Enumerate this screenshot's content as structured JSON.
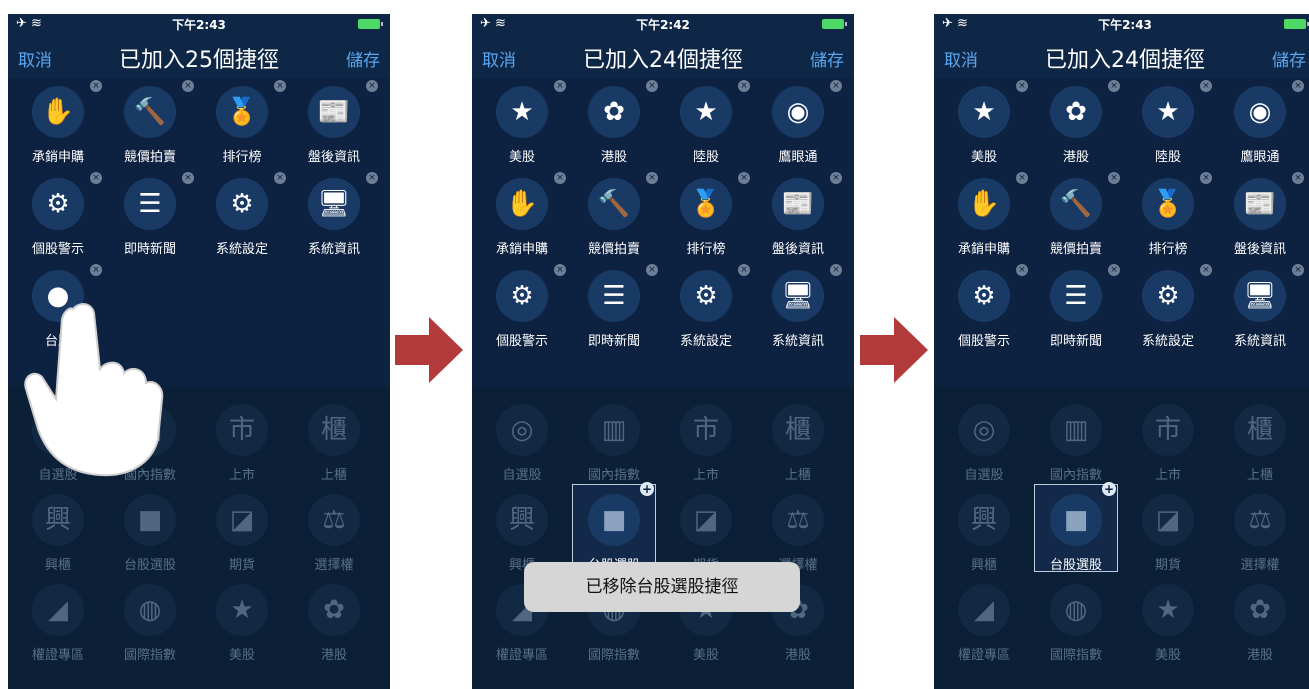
{
  "screens": [
    {
      "time": "下午2:43",
      "cancel": "取消",
      "title": "已加入25個捷徑",
      "save": "儲存",
      "added": [
        {
          "label": "承銷申購",
          "icon": "hand-icon"
        },
        {
          "label": "競價拍賣",
          "icon": "gavel-icon"
        },
        {
          "label": "排行榜",
          "icon": "medal-icon"
        },
        {
          "label": "盤後資訊",
          "icon": "document-icon"
        },
        {
          "label": "個股警示",
          "icon": "alert-gear-icon"
        },
        {
          "label": "即時新聞",
          "icon": "news-icon"
        },
        {
          "label": "系統設定",
          "icon": "gear-icon"
        },
        {
          "label": "系統資訊",
          "icon": "monitor-icon"
        },
        {
          "label": "台股",
          "icon": "taiwan-flag-icon"
        }
      ],
      "available": [
        {
          "label": "自選股"
        },
        {
          "label": "國內指數"
        },
        {
          "label": "上市"
        },
        {
          "label": "上櫃"
        },
        {
          "label": "興櫃"
        },
        {
          "label": "台股選股"
        },
        {
          "label": "期貨"
        },
        {
          "label": "選擇權"
        },
        {
          "label": "權證專區"
        },
        {
          "label": "國際指數"
        },
        {
          "label": "美股"
        },
        {
          "label": "港股"
        }
      ]
    },
    {
      "time": "下午2:42",
      "cancel": "取消",
      "title": "已加入24個捷徑",
      "save": "儲存",
      "added": [
        {
          "label": "美股",
          "icon": "us-flag-icon"
        },
        {
          "label": "港股",
          "icon": "hk-flag-icon"
        },
        {
          "label": "陸股",
          "icon": "cn-flag-icon"
        },
        {
          "label": "鷹眼通",
          "icon": "eye-icon"
        },
        {
          "label": "承銷申購",
          "icon": "hand-icon"
        },
        {
          "label": "競價拍賣",
          "icon": "gavel-icon"
        },
        {
          "label": "排行榜",
          "icon": "medal-icon"
        },
        {
          "label": "盤後資訊",
          "icon": "document-icon"
        },
        {
          "label": "個股警示",
          "icon": "alert-gear-icon"
        },
        {
          "label": "即時新聞",
          "icon": "news-icon"
        },
        {
          "label": "系統設定",
          "icon": "gear-icon"
        },
        {
          "label": "系統資訊",
          "icon": "monitor-icon"
        }
      ],
      "available": [
        {
          "label": "自選股"
        },
        {
          "label": "國內指數"
        },
        {
          "label": "上市"
        },
        {
          "label": "上櫃"
        },
        {
          "label": "興櫃"
        },
        {
          "label": "台股選股"
        },
        {
          "label": "期貨"
        },
        {
          "label": "選擇權"
        },
        {
          "label": "權證專區"
        },
        {
          "label": "國際指數"
        },
        {
          "label": "美股"
        },
        {
          "label": "港股"
        }
      ],
      "toast": "已移除台股選股捷徑"
    },
    {
      "time": "下午2:43",
      "cancel": "取消",
      "title": "已加入24個捷徑",
      "save": "儲存",
      "added": [
        {
          "label": "美股",
          "icon": "us-flag-icon"
        },
        {
          "label": "港股",
          "icon": "hk-flag-icon"
        },
        {
          "label": "陸股",
          "icon": "cn-flag-icon"
        },
        {
          "label": "鷹眼通",
          "icon": "eye-icon"
        },
        {
          "label": "承銷申購",
          "icon": "hand-icon"
        },
        {
          "label": "競價拍賣",
          "icon": "gavel-icon"
        },
        {
          "label": "排行榜",
          "icon": "medal-icon"
        },
        {
          "label": "盤後資訊",
          "icon": "document-icon"
        },
        {
          "label": "個股警示",
          "icon": "alert-gear-icon"
        },
        {
          "label": "即時新聞",
          "icon": "news-icon"
        },
        {
          "label": "系統設定",
          "icon": "gear-icon"
        },
        {
          "label": "系統資訊",
          "icon": "monitor-icon"
        }
      ],
      "available": [
        {
          "label": "自選股"
        },
        {
          "label": "國內指數"
        },
        {
          "label": "上市"
        },
        {
          "label": "上櫃"
        },
        {
          "label": "興櫃"
        },
        {
          "label": "台股選股"
        },
        {
          "label": "期貨"
        },
        {
          "label": "選擇權"
        },
        {
          "label": "權證專區"
        },
        {
          "label": "國際指數"
        },
        {
          "label": "美股"
        },
        {
          "label": "港股"
        }
      ]
    }
  ],
  "colors": {
    "background": "#0f2747",
    "accent": "#5aa6ee",
    "arrow": "#b23a3a"
  }
}
